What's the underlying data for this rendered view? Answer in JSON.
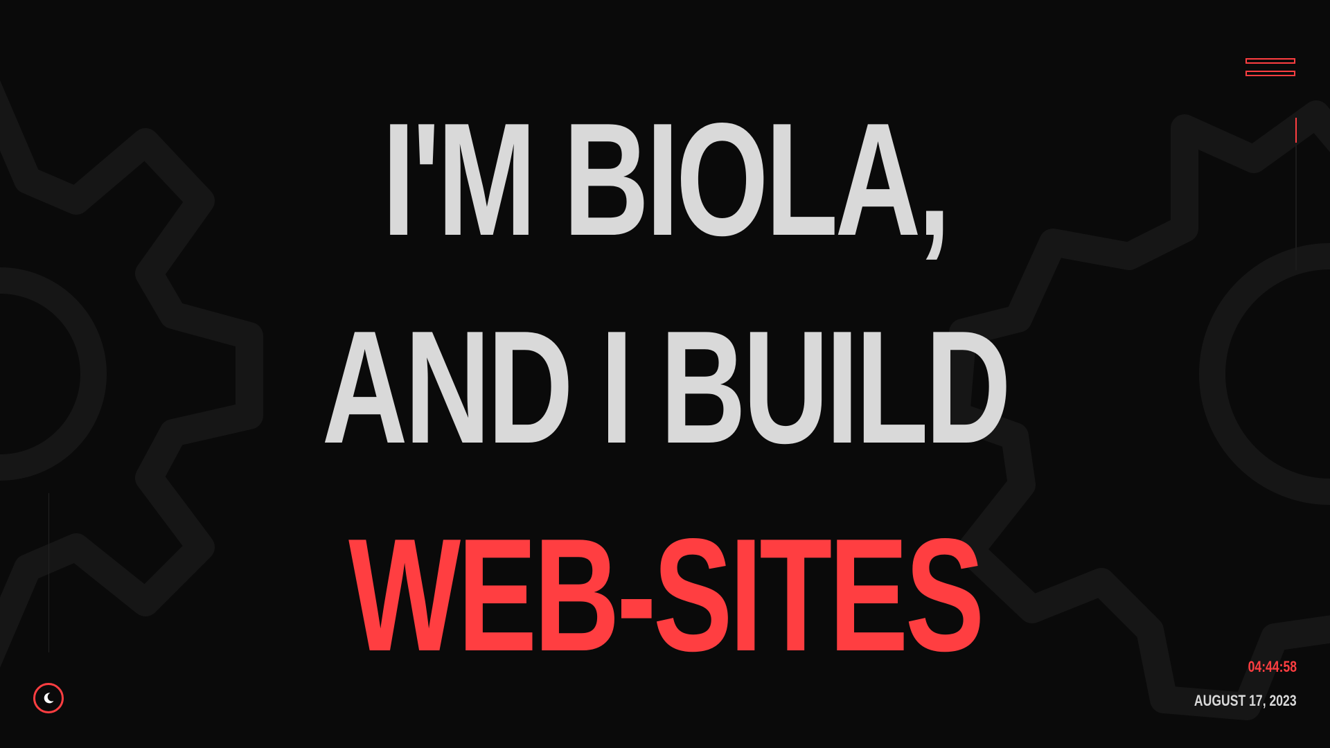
{
  "hero": {
    "line1": "I'M BIOLA,",
    "line2": "AND I BUILD",
    "line3": "WEB-SITES"
  },
  "clock": {
    "time": "04:44:58",
    "date": "AUGUST 17, 2023"
  },
  "icons": {
    "menu": "hamburger-menu-icon",
    "theme": "moon-icon",
    "background": "gear-icon"
  },
  "colors": {
    "background": "#0a0a0a",
    "text": "#d9d9d9",
    "accent": "#ff3e41",
    "gear": "#161616"
  }
}
